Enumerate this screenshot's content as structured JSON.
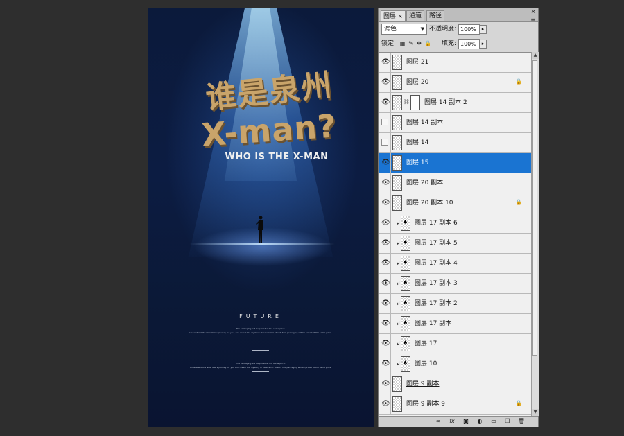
{
  "poster": {
    "title_cn": "谁是泉州",
    "title_en": "X-man?",
    "subtitle": "WHO IS THE X-MAN",
    "future": "FUTURE",
    "small_lines_1": [
      "The packaging will be priced at the same price.",
      "Understand the New Year's journey for you, and reveal the mystery of panoramic street. This packaging will be priced at the same price."
    ],
    "small_lines_2": [
      "The packaging will be priced at the same price.",
      "Understand the New Year's journey for you and reveal the mystery of panoramic street. This packaging will be priced at the same price."
    ]
  },
  "panel": {
    "tabs": [
      {
        "label": "图层",
        "close": "×"
      },
      {
        "label": "通道"
      },
      {
        "label": "路径"
      }
    ],
    "blend_mode": "滤色",
    "opacity_label": "不透明度:",
    "opacity_value": "100%",
    "lock_label": "锁定:",
    "fill_label": "填充:",
    "fill_value": "100%",
    "stepper_arrow": "▸",
    "layers": [
      {
        "name": "图层 21",
        "visible": true
      },
      {
        "name": "图层 20",
        "visible": true,
        "locked": true
      },
      {
        "name": "图层 14 副本 2",
        "visible": true,
        "mask": true
      },
      {
        "name": "图层 14 副本",
        "visible": false
      },
      {
        "name": "图层 14",
        "visible": false
      },
      {
        "name": "图层 15",
        "visible": true,
        "selected": true
      },
      {
        "name": "图层 20 副本",
        "visible": true
      },
      {
        "name": "图层 20 副本 10",
        "visible": true,
        "locked": true
      },
      {
        "name": "图层 17 副本 6",
        "visible": true,
        "clipped": true
      },
      {
        "name": "图层 17 副本 5",
        "visible": true,
        "clipped": true
      },
      {
        "name": "图层 17 副本 4",
        "visible": true,
        "clipped": true
      },
      {
        "name": "图层 17 副本 3",
        "visible": true,
        "clipped": true
      },
      {
        "name": "图层 17 副本 2",
        "visible": true,
        "clipped": true
      },
      {
        "name": "图层 17 副本",
        "visible": true,
        "clipped": true
      },
      {
        "name": "图层 17",
        "visible": true,
        "clipped": true
      },
      {
        "name": "图层 10",
        "visible": true,
        "clipped": true
      },
      {
        "name": "图层 9 副本",
        "visible": true,
        "underline": true
      },
      {
        "name": "图层 9 副本 9",
        "visible": true,
        "locked": true
      }
    ],
    "footer_icons": [
      "link-icon",
      "fx-icon",
      "mask-icon",
      "adjustment-icon",
      "group-icon",
      "new-layer-icon",
      "trash-icon"
    ]
  }
}
